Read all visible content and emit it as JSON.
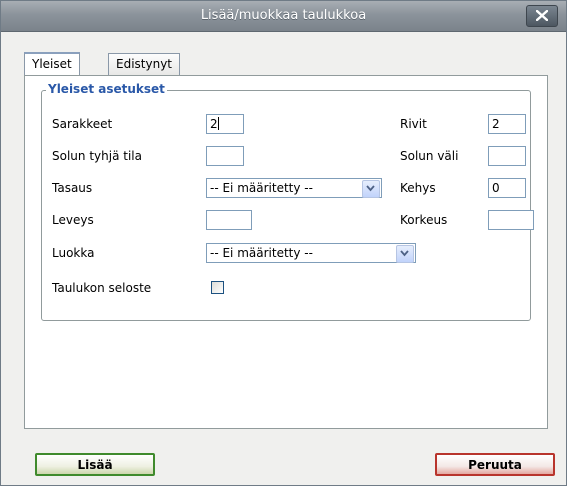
{
  "window": {
    "title": "Lisää/muokkaa taulukkoa"
  },
  "tabs": [
    {
      "label": "Yleiset",
      "active": true
    },
    {
      "label": "Edistynyt",
      "active": false
    }
  ],
  "fieldset": {
    "legend": "Yleiset asetukset"
  },
  "fields": {
    "columns": {
      "label": "Sarakkeet",
      "value": "2"
    },
    "rows": {
      "label": "Rivit",
      "value": "2"
    },
    "cellpadding": {
      "label": "Solun tyhjä tila",
      "value": ""
    },
    "cellspacing": {
      "label": "Solun väli",
      "value": ""
    },
    "align": {
      "label": "Tasaus",
      "selected": "-- Ei määritetty --"
    },
    "border": {
      "label": "Kehys",
      "value": "0"
    },
    "width": {
      "label": "Leveys",
      "value": ""
    },
    "height": {
      "label": "Korkeus",
      "value": ""
    },
    "class": {
      "label": "Luokka",
      "selected": "-- Ei määritetty --"
    },
    "caption": {
      "label": "Taulukon seloste",
      "checked": false
    }
  },
  "buttons": {
    "insert": "Lisää",
    "cancel": "Peruuta"
  },
  "icons": {
    "close": "close-icon",
    "dropdown": "chevron-down-icon"
  },
  "colors": {
    "legend": "#2a58a8",
    "insert_border": "#3f8a2c",
    "cancel_border": "#b8342c"
  }
}
